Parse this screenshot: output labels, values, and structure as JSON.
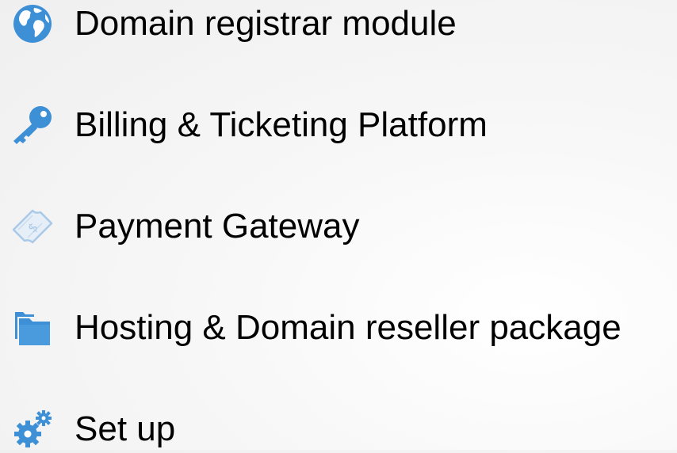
{
  "features": [
    {
      "label": "Domain registrar module",
      "icon": "globe-icon"
    },
    {
      "label": "Billing & Ticketing Platform",
      "icon": "key-icon"
    },
    {
      "label": "Payment Gateway",
      "icon": "dollar-bill-icon"
    },
    {
      "label": "Hosting & Domain reseller package",
      "icon": "folders-icon"
    },
    {
      "label": "Set up",
      "icon": "gears-icon"
    }
  ],
  "colors": {
    "icon_blue": "#3d8fd6",
    "icon_blue_dark": "#2f77b8",
    "icon_light": "#a9c9e8",
    "text": "#000000"
  }
}
